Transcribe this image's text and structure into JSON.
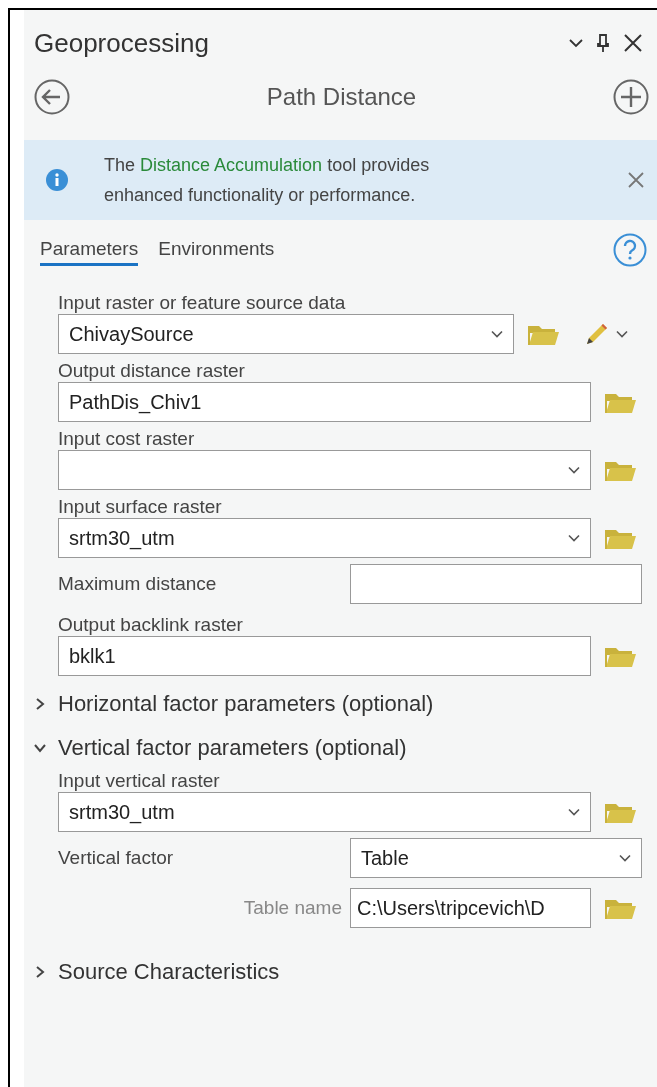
{
  "window": {
    "title": "Geoprocessing"
  },
  "tool": {
    "title": "Path Distance"
  },
  "notice": {
    "before": "The",
    "link": "Distance Accumulation",
    "after": "tool provides enhanced functionality or performance."
  },
  "tabs": [
    {
      "label": "Parameters",
      "selected": true
    },
    {
      "label": "Environments",
      "selected": false
    }
  ],
  "parameters": [
    {
      "kind": "stacked",
      "label": "Input raster or feature source data",
      "dropdown": true,
      "value": "ChivaySource",
      "folder": true,
      "edit": true
    },
    {
      "kind": "stacked",
      "label": "Output distance raster",
      "dropdown": false,
      "value": "PathDis_Chiv1",
      "folder": true
    },
    {
      "kind": "stacked",
      "label": "Input cost raster",
      "dropdown": true,
      "folder": true
    },
    {
      "kind": "stacked",
      "label": "Input surface raster",
      "dropdown": true,
      "value": "srtm30_utm",
      "folder": true
    },
    {
      "kind": "inline",
      "label": "Maximum distance",
      "dropdown": false
    },
    {
      "kind": "stacked",
      "label": "Output backlink raster",
      "dropdown": false,
      "value": "bklk1",
      "folder": true
    },
    {
      "kind": "group",
      "label": "Horizontal factor parameters (optional)",
      "expanded": false
    },
    {
      "kind": "group",
      "label": "Vertical factor parameters (optional)",
      "expanded": true,
      "children": [
        {
          "kind": "stacked",
          "label": "Input vertical raster",
          "dropdown": true,
          "value": "srtm30_utm",
          "folder": true
        },
        {
          "kind": "inline",
          "label": "Vertical factor",
          "dropdown": true,
          "value": "Table"
        },
        {
          "kind": "sub",
          "label": "Table name",
          "dropdown": false,
          "value": "C:\\Users\\tripcevich\\D",
          "folder": true
        }
      ]
    },
    {
      "kind": "group",
      "label": "Source Characteristics",
      "expanded": false
    }
  ]
}
